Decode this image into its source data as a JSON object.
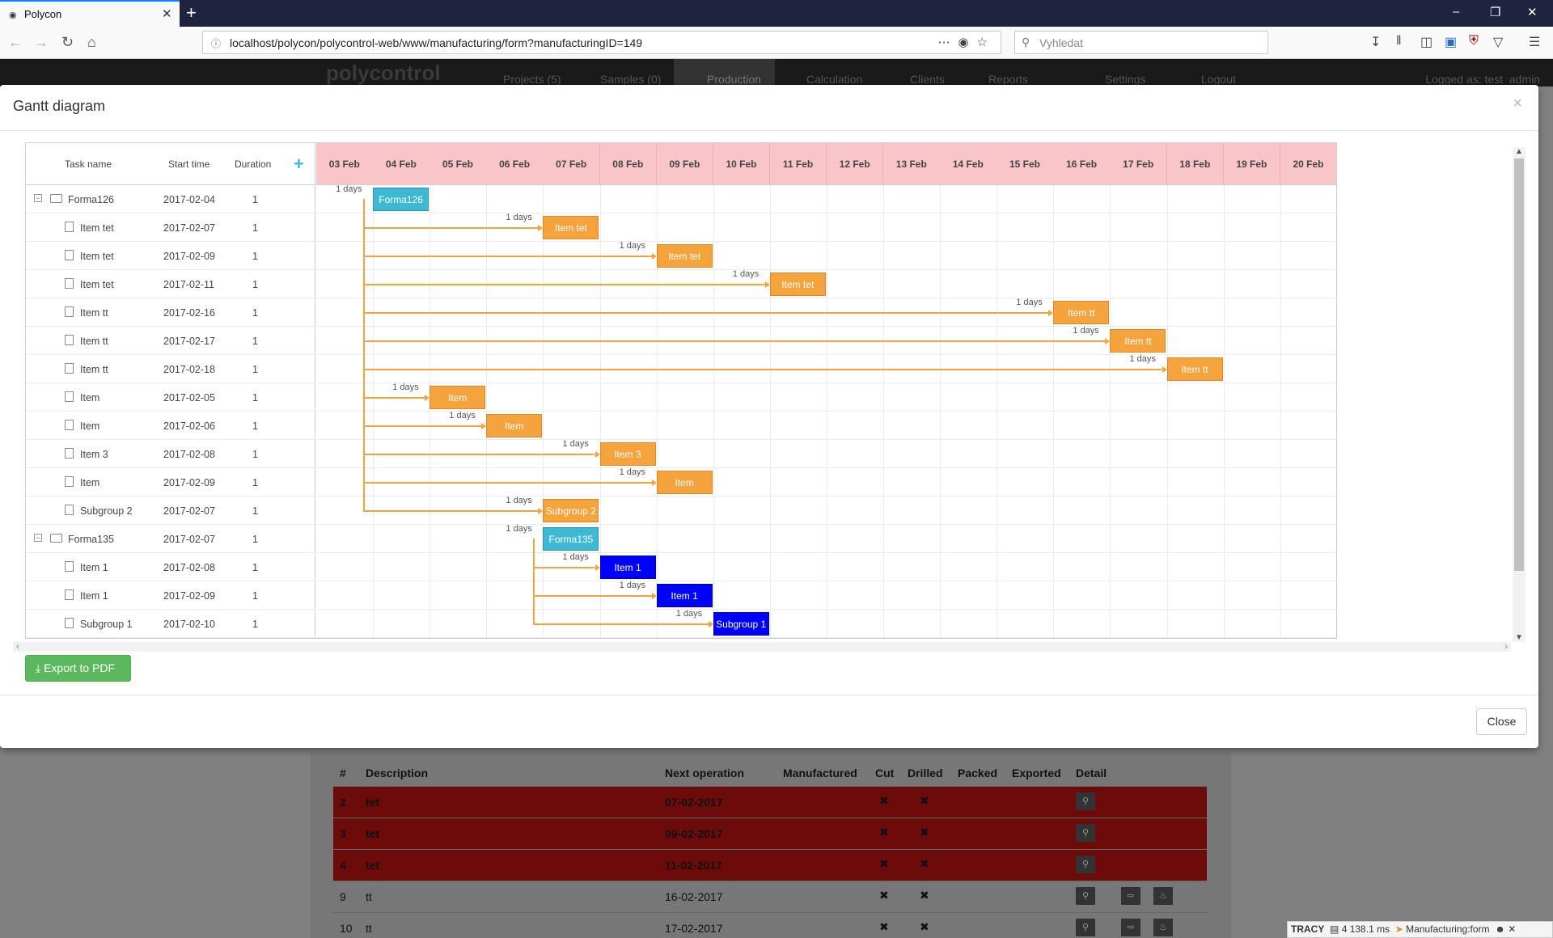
{
  "browser": {
    "tab_title": "Polycon",
    "url": "localhost/polycon/polycontrol-web/www/manufacturing/form?manufacturingID=149",
    "search_placeholder": "Vyhledat"
  },
  "app": {
    "logo": "polycontrol",
    "menu": [
      "Projects (5)",
      "Samples (0)",
      "Production",
      "Calculation",
      "Clients",
      "Reports",
      "Settings",
      "Logout"
    ],
    "logged_as": "Logged as: test_admin"
  },
  "modal": {
    "title": "Gantt diagram",
    "export_label": "Export to PDF",
    "close_label": "Close"
  },
  "gantt": {
    "columns": {
      "task": "Task name",
      "start": "Start time",
      "duration": "Duration"
    },
    "scale": [
      "03 Feb",
      "04 Feb",
      "05 Feb",
      "06 Feb",
      "07 Feb",
      "08 Feb",
      "09 Feb",
      "10 Feb",
      "11 Feb",
      "12 Feb",
      "13 Feb",
      "14 Feb",
      "15 Feb",
      "16 Feb",
      "17 Feb",
      "18 Feb",
      "19 Feb",
      "20 Feb"
    ],
    "duration_label": "1 days",
    "tasks": [
      {
        "name": "Forma126",
        "start": "2017-02-04",
        "duration": "1",
        "type": "project",
        "level": 0,
        "day": 1
      },
      {
        "name": "Item tet",
        "start": "2017-02-07",
        "duration": "1",
        "type": "orange",
        "level": 1,
        "day": 4
      },
      {
        "name": "Item tet",
        "start": "2017-02-09",
        "duration": "1",
        "type": "orange",
        "level": 1,
        "day": 6
      },
      {
        "name": "Item tet",
        "start": "2017-02-11",
        "duration": "1",
        "type": "orange",
        "level": 1,
        "day": 8
      },
      {
        "name": "Item tt",
        "start": "2017-02-16",
        "duration": "1",
        "type": "orange",
        "level": 1,
        "day": 13
      },
      {
        "name": "Item tt",
        "start": "2017-02-17",
        "duration": "1",
        "type": "orange",
        "level": 1,
        "day": 14
      },
      {
        "name": "Item tt",
        "start": "2017-02-18",
        "duration": "1",
        "type": "orange",
        "level": 1,
        "day": 15
      },
      {
        "name": "Item",
        "start": "2017-02-05",
        "duration": "1",
        "type": "orange",
        "level": 1,
        "day": 2
      },
      {
        "name": "Item",
        "start": "2017-02-06",
        "duration": "1",
        "type": "orange",
        "level": 1,
        "day": 3
      },
      {
        "name": "Item 3",
        "start": "2017-02-08",
        "duration": "1",
        "type": "orange",
        "level": 1,
        "day": 5
      },
      {
        "name": "Item",
        "start": "2017-02-09",
        "duration": "1",
        "type": "orange",
        "level": 1,
        "day": 6
      },
      {
        "name": "Subgroup 2",
        "start": "2017-02-07",
        "duration": "1",
        "type": "orange",
        "level": 1,
        "day": 4
      },
      {
        "name": "Forma135",
        "start": "2017-02-07",
        "duration": "1",
        "type": "project",
        "level": 0,
        "day": 4
      },
      {
        "name": "Item 1",
        "start": "2017-02-08",
        "duration": "1",
        "type": "blue",
        "level": 1,
        "day": 5
      },
      {
        "name": "Item 1",
        "start": "2017-02-09",
        "duration": "1",
        "type": "blue",
        "level": 1,
        "day": 6
      },
      {
        "name": "Subgroup 1",
        "start": "2017-02-10",
        "duration": "1",
        "type": "blue",
        "level": 1,
        "day": 7
      }
    ]
  },
  "bg_table": {
    "headers": [
      "#",
      "Description",
      "Next operation",
      "Manufactured",
      "Cut",
      "Drilled",
      "Packed",
      "Exported",
      "Detail"
    ],
    "rows": [
      {
        "num": "2",
        "desc": "tet",
        "next": "07-02-2017",
        "red": true
      },
      {
        "num": "3",
        "desc": "tet",
        "next": "09-02-2017",
        "red": true
      },
      {
        "num": "4",
        "desc": "tet",
        "next": "11-02-2017",
        "red": true
      },
      {
        "num": "9",
        "desc": "tt",
        "next": "16-02-2017",
        "red": false
      },
      {
        "num": "10",
        "desc": "tt",
        "next": "17-02-2017",
        "red": false
      }
    ]
  },
  "tracy": {
    "label": "TRACY",
    "time": "4 138.1 ms",
    "presenter": "Manufacturing:form"
  },
  "colors": {
    "project": "#3db9d3",
    "task": "#f5a33c",
    "task_blue": "#0000ff",
    "scale_bg": "#f9c5c8",
    "export_btn": "#5cb85c"
  }
}
